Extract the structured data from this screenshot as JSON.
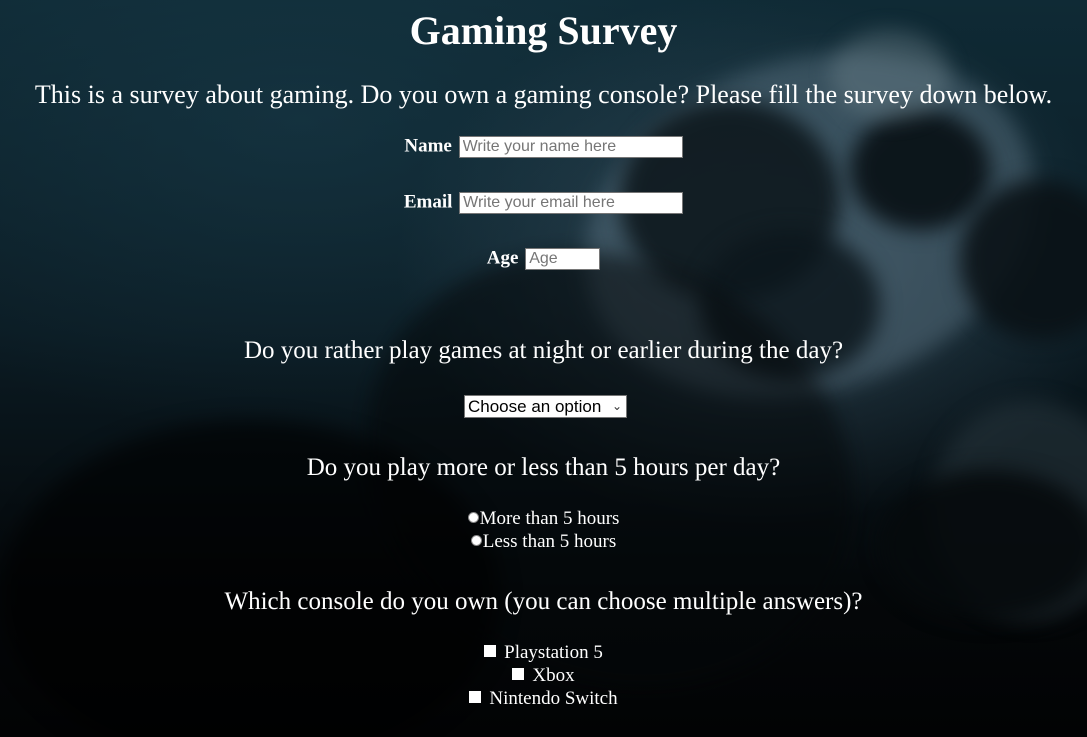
{
  "page": {
    "title": "Gaming Survey",
    "intro": "This is a survey about gaming. Do you own a gaming console? Please fill the survey down below."
  },
  "form": {
    "name": {
      "label": "Name",
      "placeholder": "Write your name here",
      "value": ""
    },
    "email": {
      "label": "Email",
      "placeholder": "Write your email here",
      "value": ""
    },
    "age": {
      "label": "Age",
      "placeholder": "Age",
      "value": ""
    }
  },
  "time_question": {
    "text": "Do you rather play games at night or earlier during the day?",
    "select": {
      "selected": "Choose an option",
      "icon": "chevron-down-icon"
    }
  },
  "hours_question": {
    "text": "Do you play more or less than 5 hours per day?",
    "options": [
      {
        "label": "More than 5 hours",
        "checked": false
      },
      {
        "label": "Less than 5 hours",
        "checked": false
      }
    ]
  },
  "console_question": {
    "text": "Which console do you own (you can choose multiple answers)?",
    "options": [
      {
        "label": "Playstation 5",
        "checked": false
      },
      {
        "label": "Xbox",
        "checked": false
      },
      {
        "label": "Nintendo Switch",
        "checked": false
      }
    ]
  },
  "colors": {
    "text": "#ffffff",
    "input_background": "#ffffff",
    "background_dark": "#0a1217"
  }
}
